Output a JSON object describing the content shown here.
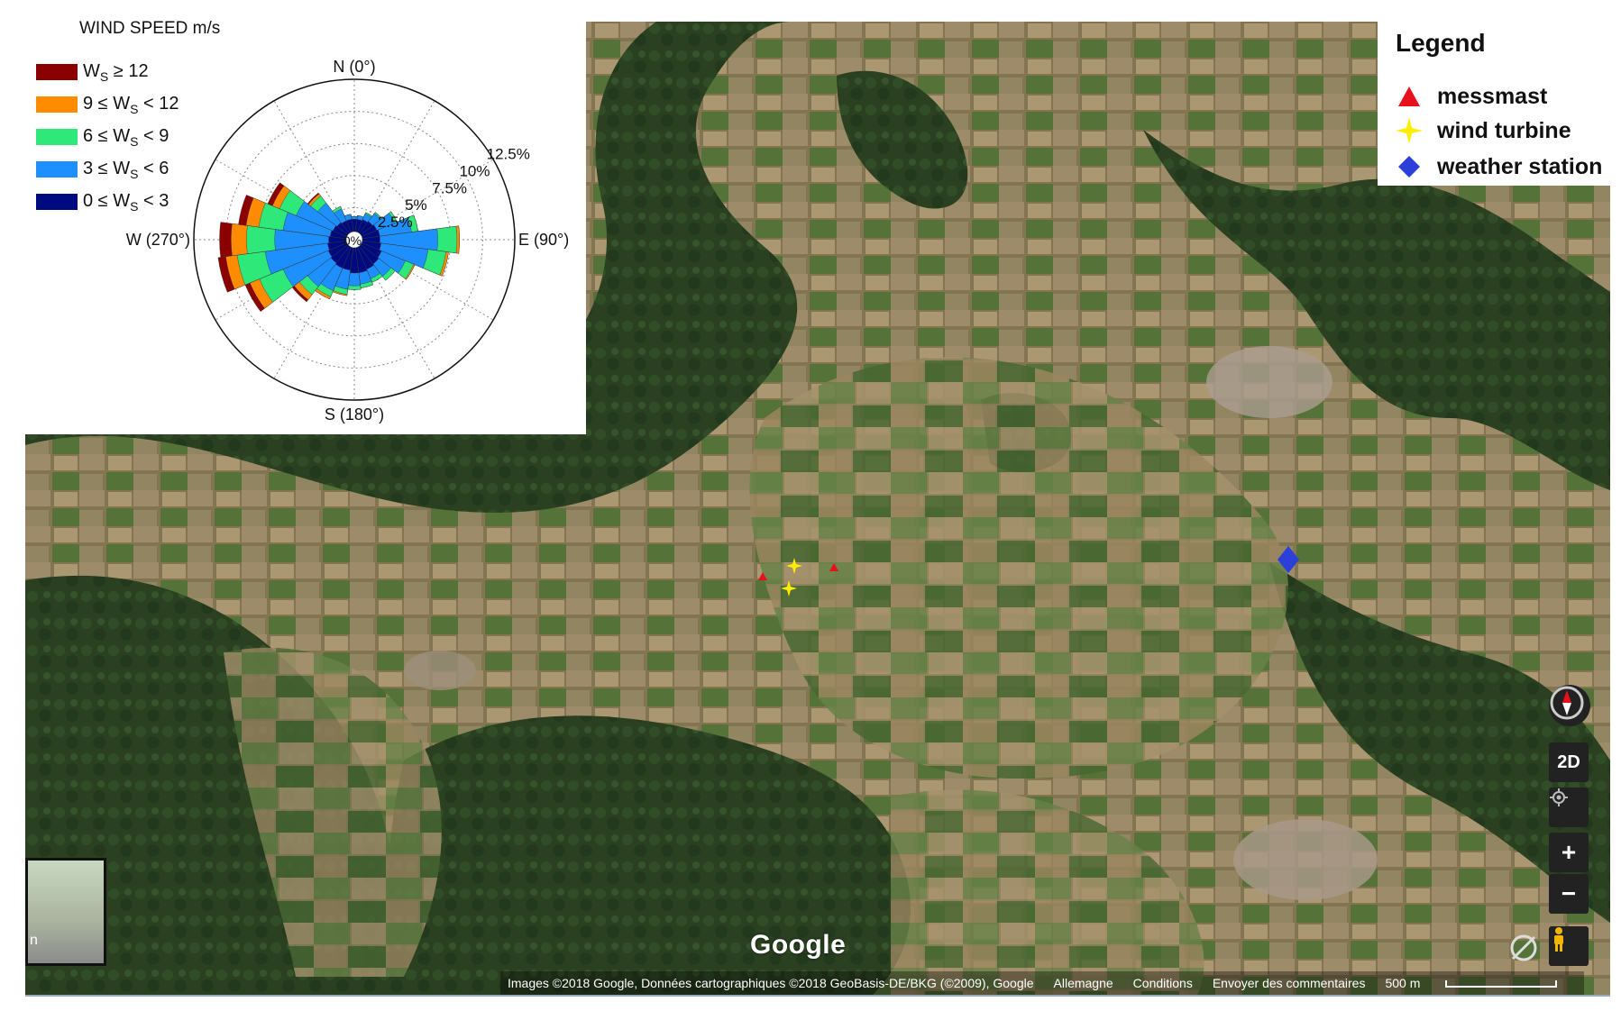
{
  "wind_rose": {
    "title": "WIND SPEED m/s",
    "legend": [
      {
        "label_main": "W",
        "label_sub": "S",
        "label_rest": " ≥ 12",
        "prefix": "",
        "color": "#8b0000"
      },
      {
        "label_main": "W",
        "label_sub": "S",
        "label_rest": " < 12",
        "prefix": "9 ≤ ",
        "color": "#ff8c00"
      },
      {
        "label_main": "W",
        "label_sub": "S",
        "label_rest": " < 9",
        "prefix": "6 ≤ ",
        "color": "#2ee87a"
      },
      {
        "label_main": "W",
        "label_sub": "S",
        "label_rest": " < 6",
        "prefix": "3 ≤ ",
        "color": "#1e8fff"
      },
      {
        "label_main": "W",
        "label_sub": "S",
        "label_rest": " < 3",
        "prefix": "0 ≤ ",
        "color": "#000a80"
      }
    ],
    "directions": {
      "n": "N (0°)",
      "e": "E (90°)",
      "s": "S (180°)",
      "w": "W (270°)"
    },
    "ring_labels": [
      "2.5%",
      "5%",
      "7.5%",
      "10%",
      "12.5%"
    ],
    "center_label": "0%"
  },
  "chart_data": {
    "type": "wind-rose",
    "title": "WIND SPEED m/s",
    "radial_ticks": [
      "0%",
      "2.5%",
      "5%",
      "7.5%",
      "10%",
      "12.5%"
    ],
    "rmax": 12.5,
    "bins": [
      "0 ≤ Ws < 3",
      "3 ≤ Ws < 6",
      "6 ≤ Ws < 9",
      "9 ≤ Ws < 12",
      "Ws ≥ 12"
    ],
    "colors": [
      "#000a80",
      "#1e8fff",
      "#2ee87a",
      "#ff8c00",
      "#8b0000"
    ],
    "sectors": [
      {
        "dir": 0,
        "cum": [
          1.6,
          1.8,
          1.8,
          1.8,
          1.8
        ]
      },
      {
        "dir": 15,
        "cum": [
          1.6,
          1.9,
          1.9,
          1.9,
          1.9
        ]
      },
      {
        "dir": 30,
        "cum": [
          1.7,
          2.2,
          2.3,
          2.3,
          2.3
        ]
      },
      {
        "dir": 45,
        "cum": [
          1.8,
          2.6,
          2.7,
          2.7,
          2.7
        ]
      },
      {
        "dir": 60,
        "cum": [
          1.9,
          3.4,
          3.6,
          3.6,
          3.6
        ]
      },
      {
        "dir": 75,
        "cum": [
          2.0,
          4.5,
          5.0,
          5.0,
          5.0
        ]
      },
      {
        "dir": 90,
        "cum": [
          2.0,
          6.5,
          8.0,
          8.2,
          8.2
        ]
      },
      {
        "dir": 105,
        "cum": [
          2.1,
          5.8,
          7.2,
          7.4,
          7.4
        ]
      },
      {
        "dir": 120,
        "cum": [
          2.3,
          4.3,
          5.0,
          5.1,
          5.1
        ]
      },
      {
        "dir": 135,
        "cum": [
          2.4,
          3.6,
          4.0,
          4.0,
          4.0
        ]
      },
      {
        "dir": 150,
        "cum": [
          2.5,
          3.3,
          3.6,
          3.6,
          3.6
        ]
      },
      {
        "dir": 165,
        "cum": [
          2.6,
          3.5,
          3.8,
          3.8,
          3.8
        ]
      },
      {
        "dir": 180,
        "cum": [
          2.6,
          3.6,
          3.9,
          3.9,
          3.9
        ]
      },
      {
        "dir": 195,
        "cum": [
          2.4,
          3.9,
          4.3,
          4.4,
          4.4
        ]
      },
      {
        "dir": 210,
        "cum": [
          2.4,
          4.3,
          4.8,
          5.0,
          5.0
        ]
      },
      {
        "dir": 225,
        "cum": [
          2.3,
          4.6,
          5.4,
          5.9,
          6.1
        ]
      },
      {
        "dir": 240,
        "cum": [
          2.2,
          6.0,
          8.0,
          8.8,
          9.2
        ]
      },
      {
        "dir": 255,
        "cum": [
          2.1,
          7.0,
          9.2,
          10.1,
          10.7
        ]
      },
      {
        "dir": 270,
        "cum": [
          2.0,
          6.2,
          8.4,
          9.6,
          10.5
        ]
      },
      {
        "dir": 285,
        "cum": [
          1.9,
          5.6,
          7.5,
          8.5,
          9.1
        ]
      },
      {
        "dir": 300,
        "cum": [
          1.8,
          4.9,
          6.3,
          6.9,
          7.3
        ]
      },
      {
        "dir": 315,
        "cum": [
          1.7,
          3.6,
          4.3,
          4.5,
          4.6
        ]
      },
      {
        "dir": 330,
        "cum": [
          1.6,
          2.6,
          2.8,
          2.8,
          2.8
        ]
      },
      {
        "dir": 345,
        "cum": [
          1.6,
          2.0,
          2.0,
          2.0,
          2.0
        ]
      }
    ]
  },
  "legend": {
    "title": "Legend",
    "items": [
      {
        "label": "messmast",
        "icon": "red-triangle-icon",
        "color": "#e8101a"
      },
      {
        "label": "wind turbine",
        "icon": "yellow-star-icon",
        "color": "#ffee00"
      },
      {
        "label": "weather station",
        "icon": "blue-diamond-icon",
        "color": "#2b3fd9"
      }
    ]
  },
  "map": {
    "provider_logo": "Google",
    "controls": {
      "mode": "2D",
      "zoom_in": "+",
      "zoom_out": "−"
    },
    "minimap_label": "n",
    "attribution": {
      "images": "Images ©2018 Google, Données cartographiques ©2018 GeoBasis-DE/BKG (©2009), Google",
      "country": "Allemagne",
      "conditions": "Conditions",
      "feedback": "Envoyer des commentaires",
      "scale": "500 m"
    }
  }
}
